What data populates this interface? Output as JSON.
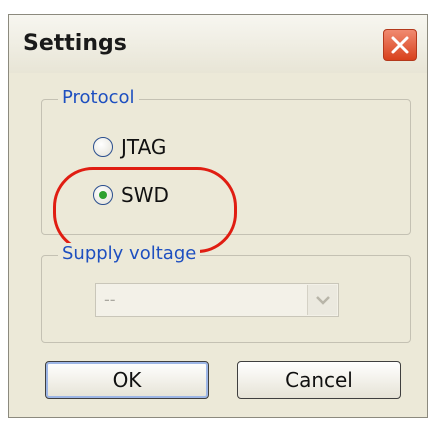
{
  "window": {
    "title": "Settings"
  },
  "protocol": {
    "legend": "Protocol",
    "options": [
      {
        "label": "JTAG",
        "checked": false
      },
      {
        "label": "SWD",
        "checked": true
      }
    ]
  },
  "supply": {
    "legend": "Supply voltage",
    "value": "--"
  },
  "buttons": {
    "ok": "OK",
    "cancel": "Cancel"
  },
  "colors": {
    "highlight": "#e01d12",
    "legend_text": "#1d4fc0",
    "radio_dot": "#2ea12e"
  }
}
